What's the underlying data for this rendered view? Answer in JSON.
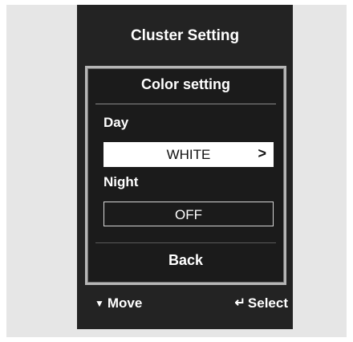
{
  "cluster": {
    "title": "Cluster Setting"
  },
  "panel": {
    "title": "Color setting",
    "day": {
      "label": "Day",
      "value": "WHITE",
      "arrow": ">"
    },
    "night": {
      "label": "Night",
      "value": "OFF"
    },
    "back_label": "Back"
  },
  "footer": {
    "move_icon": "▼",
    "move_label": "Move",
    "select_icon": "↵",
    "select_label": "Select"
  },
  "colors": {
    "screen_bg": "#232323",
    "panel_border": "#b6b6b6",
    "frame_bg": "#e6e6e6",
    "selected_bg": "#ffffff"
  }
}
